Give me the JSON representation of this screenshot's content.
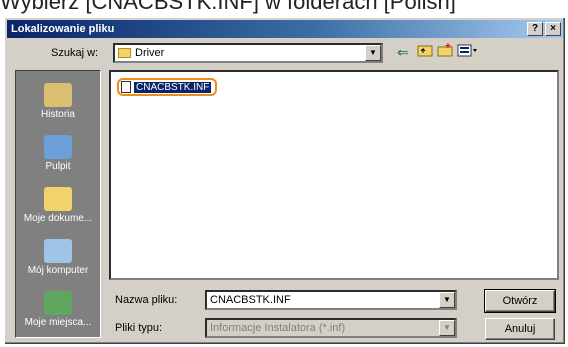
{
  "caption": "Wybierz [CNACBSTK.INF] w folderach [Polish]",
  "window": {
    "title": "Lokalizowanie pliku",
    "help_label": "?",
    "close_label": "×"
  },
  "look_in": {
    "label": "Szukaj w:",
    "value": "Driver"
  },
  "places": [
    {
      "label": "Historia",
      "icon": "history-icon",
      "color": "#d8c070"
    },
    {
      "label": "Pulpit",
      "icon": "desktop-icon",
      "color": "#6a9fd8"
    },
    {
      "label": "Moje dokume...",
      "icon": "my-documents-icon",
      "color": "#f2d36b"
    },
    {
      "label": "Mój komputer",
      "icon": "my-computer-icon",
      "color": "#a0c4e8"
    },
    {
      "label": "Moje miejsca...",
      "icon": "network-places-icon",
      "color": "#5fa65f"
    }
  ],
  "files": [
    {
      "name": "CNACBSTK.INF",
      "selected": true
    }
  ],
  "filename": {
    "label": "Nazwa pliku:",
    "value": "CNACBSTK.INF"
  },
  "filetype": {
    "label": "Pliki typu:",
    "value": "Informacje Instalatora (*.inf)"
  },
  "buttons": {
    "open": "Otwórz",
    "cancel": "Anuluj"
  }
}
